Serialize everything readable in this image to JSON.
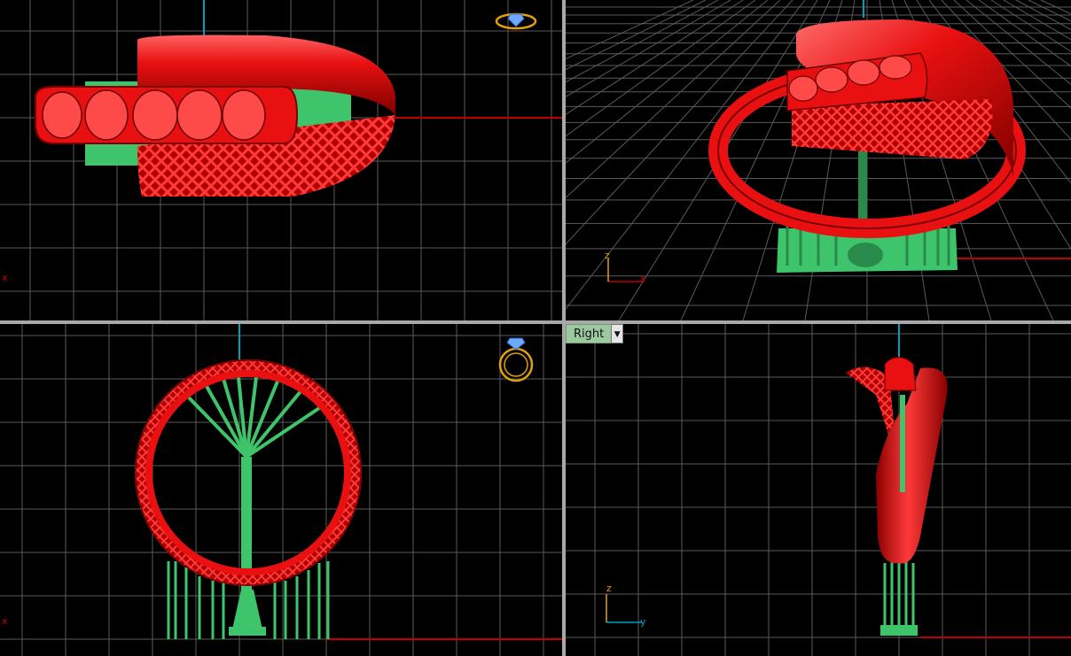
{
  "viewports": {
    "top": {
      "axis_labels": {
        "x": "x"
      }
    },
    "perspective": {
      "axis_labels": {
        "x": "x",
        "z": "z"
      }
    },
    "front": {
      "axis_labels": {
        "x": "x"
      }
    },
    "right": {
      "title": "Right",
      "axis_labels": {
        "y": "y",
        "z": "z"
      }
    }
  },
  "colors": {
    "background": "#000000",
    "grid": "#5a5a5a",
    "grid_major": "#808080",
    "x_axis": "#c00000",
    "y_axis": "#00a0c0",
    "model": "#e81010",
    "supports": "#3ec46a",
    "widget": "#e0a010",
    "title_bg": "#9cc9a0"
  },
  "icons": {
    "view_widget": "ring-gem-icon",
    "dropdown": "dropdown-arrow-icon"
  }
}
